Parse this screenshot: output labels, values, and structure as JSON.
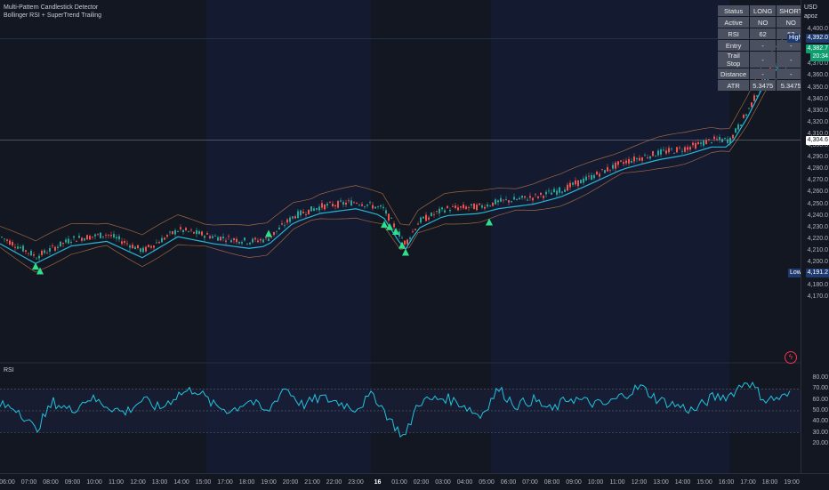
{
  "indicators": {
    "line1": "Multi-Pattern Candlestick Detector",
    "line2": "Bollinger RSI + SuperTrend Trailing"
  },
  "rsi_pane_label": "RSI",
  "axis_header": {
    "currency": "USD",
    "unit": "apoz"
  },
  "status_table": {
    "header": [
      "Status",
      "LONG",
      "SHORT"
    ],
    "rows": [
      {
        "label": "Active",
        "long": "NO",
        "short": "NO"
      },
      {
        "label": "RSI",
        "long": "62",
        "short": "62"
      },
      {
        "label": "Entry",
        "long": "-",
        "short": "-"
      },
      {
        "label": "Trail Stop",
        "long": "-",
        "short": "-"
      },
      {
        "label": "Distance",
        "long": "-",
        "short": "-"
      },
      {
        "label": "ATR",
        "long": "5.3475",
        "short": "5.3475"
      }
    ]
  },
  "price_ticks": [
    "4,400.0",
    "4,390.0",
    "4,380.0",
    "4,370.0",
    "4,360.0",
    "4,350.0",
    "4,340.0",
    "4,330.0",
    "4,320.0",
    "4,310.0",
    "4,300.0",
    "4,290.0",
    "4,280.0",
    "4,270.0",
    "4,260.0",
    "4,250.0",
    "4,240.0",
    "4,230.0",
    "4,220.0",
    "4,210.0",
    "4,200.0",
    "4,190.0",
    "4,180.0",
    "4,170.0"
  ],
  "price_tags": {
    "high_label": "High",
    "high_value": "4,392.0",
    "current_value": "4,382.7",
    "countdown": "20:34",
    "crosshair_value": "4,304.6",
    "low_label": "Low",
    "low_value": "4,191.2"
  },
  "rsi_ticks": [
    "80.00",
    "70.00",
    "60.00",
    "50.00",
    "40.00",
    "30.00",
    "20.00"
  ],
  "time_ticks": [
    {
      "label": "06:00",
      "bold": false
    },
    {
      "label": "07:00",
      "bold": false
    },
    {
      "label": "08:00",
      "bold": false
    },
    {
      "label": "09:00",
      "bold": false
    },
    {
      "label": "10:00",
      "bold": false
    },
    {
      "label": "11:00",
      "bold": false
    },
    {
      "label": "12:00",
      "bold": false
    },
    {
      "label": "13:00",
      "bold": false
    },
    {
      "label": "14:00",
      "bold": false
    },
    {
      "label": "15:00",
      "bold": false
    },
    {
      "label": "17:00",
      "bold": false
    },
    {
      "label": "18:00",
      "bold": false
    },
    {
      "label": "19:00",
      "bold": false
    },
    {
      "label": "20:00",
      "bold": false
    },
    {
      "label": "21:00",
      "bold": false
    },
    {
      "label": "22:00",
      "bold": false
    },
    {
      "label": "23:00",
      "bold": false
    },
    {
      "label": "16",
      "bold": true
    },
    {
      "label": "01:00",
      "bold": false
    },
    {
      "label": "02:00",
      "bold": false
    },
    {
      "label": "03:00",
      "bold": false
    },
    {
      "label": "04:00",
      "bold": false
    },
    {
      "label": "05:00",
      "bold": false
    },
    {
      "label": "06:00",
      "bold": false
    },
    {
      "label": "07:00",
      "bold": false
    },
    {
      "label": "08:00",
      "bold": false
    },
    {
      "label": "09:00",
      "bold": false
    },
    {
      "label": "10:00",
      "bold": false
    },
    {
      "label": "11:00",
      "bold": false
    },
    {
      "label": "12:00",
      "bold": false
    },
    {
      "label": "13:00",
      "bold": false
    },
    {
      "label": "14:00",
      "bold": false
    },
    {
      "label": "15:00",
      "bold": false
    },
    {
      "label": "16:00",
      "bold": false
    },
    {
      "label": "17:00",
      "bold": false
    },
    {
      "label": "18:00",
      "bold": false
    },
    {
      "label": "19:00",
      "bold": false
    }
  ],
  "chart_data": {
    "type": "line",
    "price_path": [
      [
        0,
        4222
      ],
      [
        40,
        4205
      ],
      [
        80,
        4220
      ],
      [
        120,
        4224
      ],
      [
        160,
        4210
      ],
      [
        200,
        4228
      ],
      [
        240,
        4222
      ],
      [
        280,
        4218
      ],
      [
        300,
        4220
      ],
      [
        330,
        4240
      ],
      [
        360,
        4248
      ],
      [
        400,
        4252
      ],
      [
        430,
        4246
      ],
      [
        445,
        4228
      ],
      [
        455,
        4216
      ],
      [
        470,
        4235
      ],
      [
        500,
        4246
      ],
      [
        540,
        4248
      ],
      [
        560,
        4252
      ],
      [
        600,
        4256
      ],
      [
        630,
        4262
      ],
      [
        660,
        4272
      ],
      [
        700,
        4286
      ],
      [
        740,
        4294
      ],
      [
        770,
        4298
      ],
      [
        800,
        4305
      ],
      [
        820,
        4305
      ],
      [
        840,
        4330
      ],
      [
        860,
        4360
      ],
      [
        880,
        4378
      ],
      [
        890,
        4385
      ]
    ],
    "buy_signal_prices": [
      4196,
      4192,
      4224,
      4232,
      4230,
      4226,
      4214,
      4208,
      4234
    ],
    "rsi_path": [
      [
        0,
        55
      ],
      [
        20,
        52
      ],
      [
        40,
        32
      ],
      [
        60,
        58
      ],
      [
        80,
        50
      ],
      [
        100,
        62
      ],
      [
        120,
        55
      ],
      [
        140,
        48
      ],
      [
        160,
        60
      ],
      [
        180,
        52
      ],
      [
        200,
        65
      ],
      [
        220,
        70
      ],
      [
        240,
        55
      ],
      [
        260,
        50
      ],
      [
        280,
        60
      ],
      [
        300,
        48
      ],
      [
        320,
        72
      ],
      [
        340,
        55
      ],
      [
        360,
        62
      ],
      [
        380,
        58
      ],
      [
        400,
        52
      ],
      [
        420,
        65
      ],
      [
        440,
        40
      ],
      [
        455,
        25
      ],
      [
        470,
        58
      ],
      [
        500,
        62
      ],
      [
        520,
        56
      ],
      [
        540,
        45
      ],
      [
        560,
        70
      ],
      [
        580,
        55
      ],
      [
        600,
        60
      ],
      [
        620,
        50
      ],
      [
        640,
        62
      ],
      [
        660,
        58
      ],
      [
        680,
        55
      ],
      [
        700,
        64
      ],
      [
        720,
        72
      ],
      [
        740,
        60
      ],
      [
        760,
        55
      ],
      [
        780,
        50
      ],
      [
        800,
        62
      ],
      [
        820,
        64
      ],
      [
        840,
        78
      ],
      [
        860,
        60
      ],
      [
        880,
        62
      ],
      [
        890,
        65
      ]
    ],
    "rsi_levels": [
      70,
      50,
      30
    ]
  }
}
